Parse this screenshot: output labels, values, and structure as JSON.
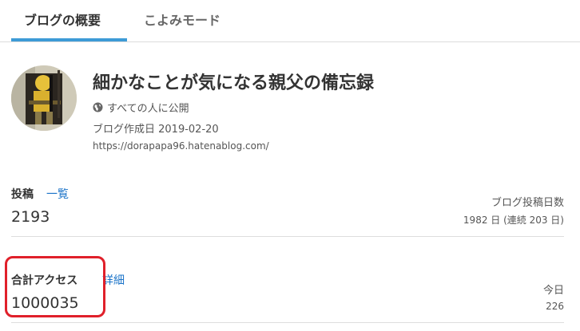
{
  "tabs": [
    {
      "label": "ブログの概要",
      "active": true
    },
    {
      "label": "こよみモード",
      "active": false
    }
  ],
  "blog": {
    "title": "細かなことが気になる親父の備忘録",
    "visibility": "すべての人に公開",
    "created": "ブログ作成日 2019-02-20",
    "url": "https://dorapapa96.hatenablog.com/"
  },
  "posts": {
    "label": "投稿",
    "link": "一覧",
    "count": "2193",
    "days_label": "ブログ投稿日数",
    "days_value": "1982 日 (連続 203 日)"
  },
  "access": {
    "label": "合計アクセス",
    "link": "詳細",
    "count": "1000035",
    "today_label": "今日",
    "today_value": "226"
  },
  "colors": {
    "accent": "#3d9bd6",
    "link": "#1a73c8",
    "highlight": "#e0202a"
  },
  "icons": {
    "visibility": "globe-icon"
  }
}
